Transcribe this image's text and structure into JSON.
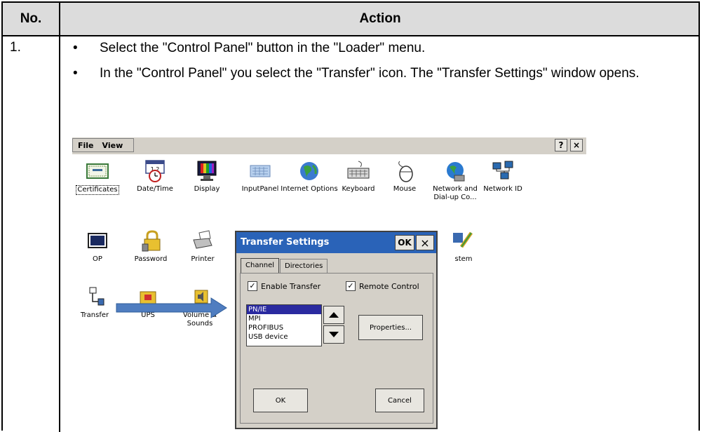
{
  "table": {
    "col_no": "No.",
    "col_action": "Action",
    "step_number": "1.",
    "bullets": [
      "Select the \"Control Panel\" button in the \"Loader\" menu.",
      "In the \"Control Panel\" you select the \"Transfer\" icon. The \"Transfer Settings\" window opens."
    ],
    "bullet_glyph": "•"
  },
  "control_panel": {
    "menu": [
      "File",
      "View"
    ],
    "help_button": "?",
    "close_button": "×",
    "items": [
      {
        "label": "Certificates",
        "icon": "certificate-icon"
      },
      {
        "label": "Date/Time",
        "icon": "calendar-clock-icon"
      },
      {
        "label": "Display",
        "icon": "monitor-icon"
      },
      {
        "label": "InputPanel",
        "icon": "keyboard-panel-icon"
      },
      {
        "label": "Internet Options",
        "icon": "globe-icon"
      },
      {
        "label": "Keyboard",
        "icon": "keyboard-icon"
      },
      {
        "label": "Mouse",
        "icon": "mouse-icon"
      },
      {
        "label": "Network and Dial-up Co...",
        "icon": "network-globe-icon"
      },
      {
        "label": "Network ID",
        "icon": "network-computers-icon"
      },
      {
        "label": "OP",
        "icon": "monitor-op-icon"
      },
      {
        "label": "Password",
        "icon": "padlock-icon"
      },
      {
        "label": "Printer",
        "icon": "printer-icon"
      },
      {
        "label": "stem",
        "icon": "system-icon"
      },
      {
        "label": "Transfer",
        "icon": "transfer-icon"
      },
      {
        "label": "UPS",
        "icon": "ups-icon"
      },
      {
        "label": "Volume & Sounds",
        "icon": "speaker-icon"
      }
    ]
  },
  "dialog": {
    "title": "Transfer Settings",
    "ok_top": "OK",
    "close_top": "×",
    "tabs": [
      "Channel",
      "Directories"
    ],
    "enable_transfer": "Enable Transfer",
    "remote_control": "Remote Control",
    "check_glyph": "✓",
    "channels": [
      "PN/IE",
      "MPI",
      "PROFIBUS",
      "USB device"
    ],
    "selected_channel": "PN/IE",
    "properties_button": "Properties...",
    "ok_button": "OK",
    "cancel_button": "Cancel"
  },
  "colors": {
    "header_bg": "#dcdcdc",
    "title_bar": "#2a63b8",
    "arrow": "#4f7dc0",
    "selection": "#2a2aa0"
  }
}
